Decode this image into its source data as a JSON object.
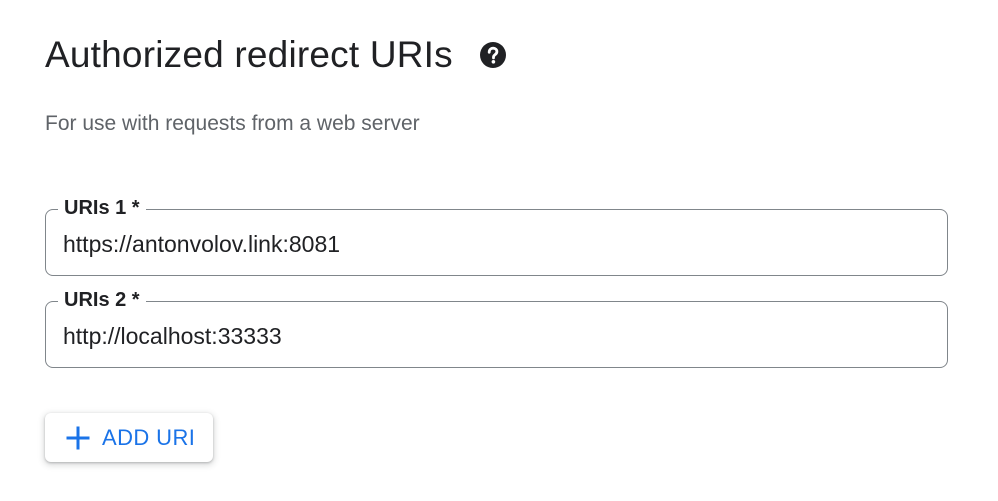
{
  "section": {
    "title": "Authorized redirect URIs",
    "help_icon": "help-circle-icon",
    "subtitle": "For use with requests from a web server"
  },
  "uris": [
    {
      "label": "URIs 1 *",
      "value": "https://antonvolov.link:8081"
    },
    {
      "label": "URIs 2 *",
      "value": "http://localhost:33333"
    }
  ],
  "add_button": {
    "icon": "plus-icon",
    "label": "ADD URI"
  },
  "colors": {
    "accent": "#1a73e8",
    "text": "#202124",
    "secondary_text": "#5f6368",
    "border": "#80868b"
  }
}
